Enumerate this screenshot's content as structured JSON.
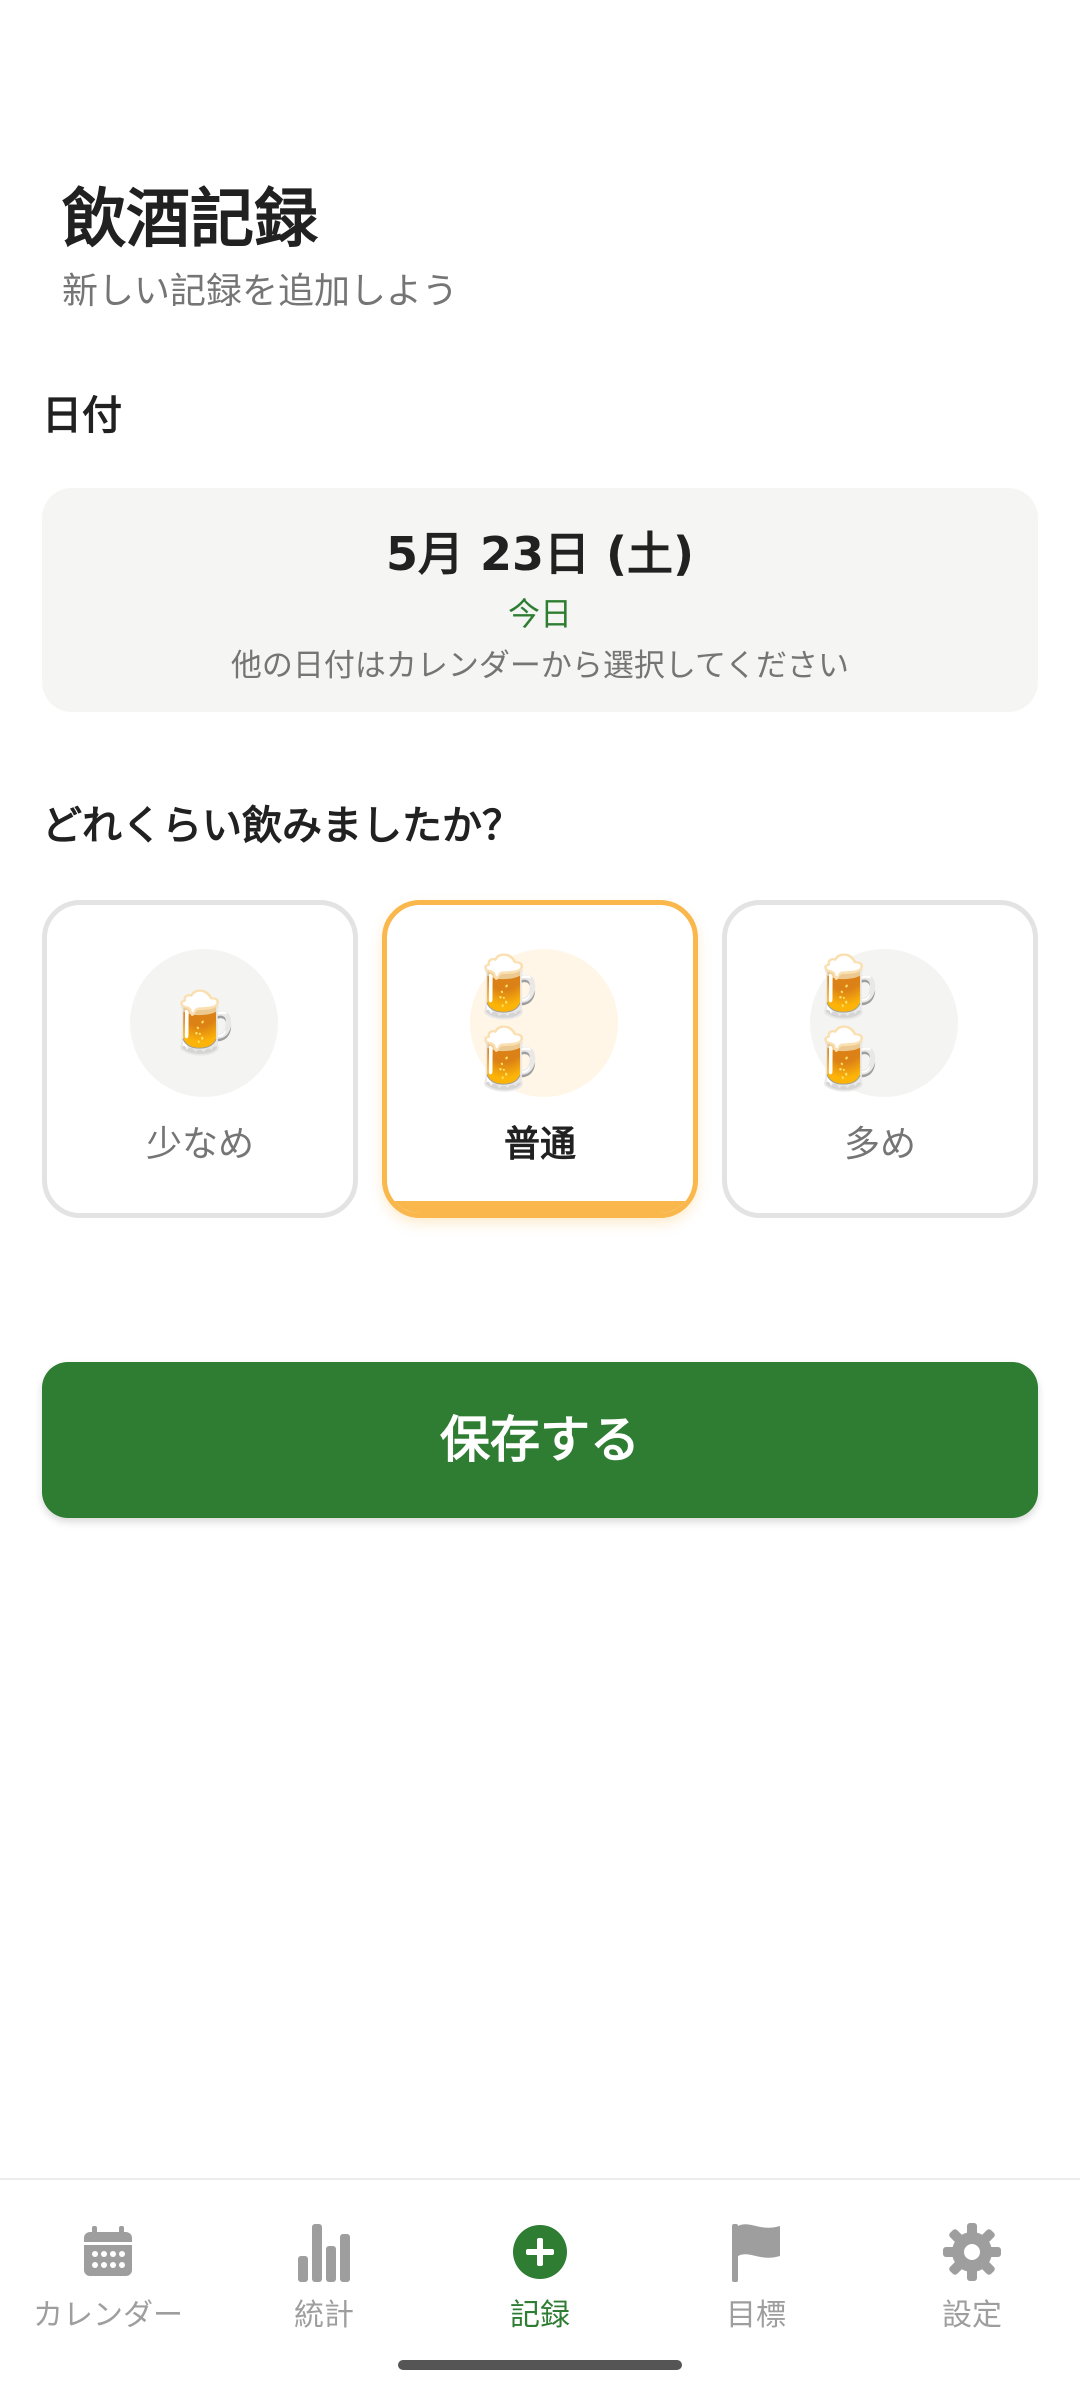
{
  "header": {
    "title": "飲酒記録",
    "subtitle": "新しい記録を追加しよう"
  },
  "date_section": {
    "label": "日付",
    "date": "5月 23日 (土)",
    "today": "今日",
    "hint": "他の日付はカレンダーから選択してください"
  },
  "amount_section": {
    "label": "どれくらい飲みましたか？",
    "options": [
      {
        "label": "少なめ",
        "icon": "beer-mug-icon",
        "count": 1,
        "selected": false
      },
      {
        "label": "普通",
        "icon": "beer-mug-icon",
        "count": 2,
        "selected": true
      },
      {
        "label": "多め",
        "icon": "beer-mug-icon",
        "count": 2,
        "selected": false
      }
    ],
    "beer_glyph": "🍺"
  },
  "save_button": {
    "label": "保存する"
  },
  "nav": {
    "items": [
      {
        "label": "カレンダー",
        "icon": "calendar-icon",
        "active": false
      },
      {
        "label": "統計",
        "icon": "bar-chart-icon",
        "active": false
      },
      {
        "label": "記録",
        "icon": "add-circle-icon",
        "active": true
      },
      {
        "label": "目標",
        "icon": "flag-icon",
        "active": false
      },
      {
        "label": "設定",
        "icon": "gear-icon",
        "active": false
      }
    ]
  },
  "colors": {
    "accent": "#2e7d32",
    "selected_border": "#f9b74c",
    "muted_text": "#757575",
    "nav_inactive": "#9e9e9e"
  }
}
